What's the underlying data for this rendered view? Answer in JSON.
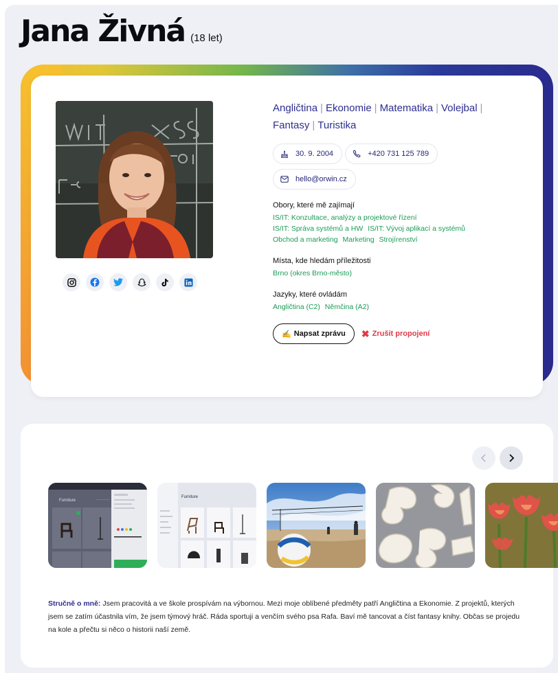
{
  "profile": {
    "name": "Jana Živná",
    "age": "(18 let)",
    "interests": [
      "Angličtina",
      "Ekonomie",
      "Matematika",
      "Volejbal",
      "Fantasy",
      "Turistika"
    ],
    "birthdate": "30. 9. 2004",
    "phone": "+420 731 125 789",
    "email": "hello@orwin.cz",
    "fields_heading": "Obory, které mě zajímají",
    "fields_lines": [
      [
        "IS/IT: Konzultace, analýzy a projektové řízení"
      ],
      [
        "IS/IT: Správa systémů a HW",
        "IS/IT: Vývoj aplikací a systémů"
      ],
      [
        "Obchod a marketing",
        "Marketing",
        "Strojírenství"
      ]
    ],
    "places_heading": "Místa, kde hledám příležitosti",
    "places": "Brno (okres Brno-město)",
    "languages_heading": "Jazyky, které ovládám",
    "languages": [
      "Angličtina (C2)",
      "Němčina (A2)"
    ],
    "message_button": "Napsat zprávu",
    "message_icon": "✍",
    "cancel_button": "Zrušit propojení",
    "cancel_icon": "✖"
  },
  "socials": [
    {
      "icon": "instagram-icon"
    },
    {
      "icon": "facebook-icon"
    },
    {
      "icon": "twitter-icon"
    },
    {
      "icon": "snapchat-icon"
    },
    {
      "icon": "tiktok-icon"
    },
    {
      "icon": "linkedin-icon"
    }
  ],
  "gallery": {
    "items": [
      "furniture-app-screenshot-1",
      "furniture-app-screenshot-2",
      "volleyball-beach-photo",
      "numbers-photo",
      "tulips-photo"
    ],
    "thumb_text_1": "Furniture",
    "thumb_text_2": "Furniture"
  },
  "about": {
    "label": "Stručně o mně:",
    "text": " Jsem pracovitá a ve škole prospívám na výbornou. Mezi moje oblíbené předměty patří Angličtina a Ekonomie. Z projektů, kterých jsem se zatím účastnila vím, že jsem týmový hráč. Ráda sportuji a venčím svého psa Rafa. Baví mě tancovat a číst fantasy knihy. Občas se projedu na kole a přečtu si něco o historii naší země."
  },
  "colors": {
    "accent": "#2d2e8f",
    "green": "#1a9b55",
    "danger": "#e03a48",
    "background": "#eef0f5"
  }
}
